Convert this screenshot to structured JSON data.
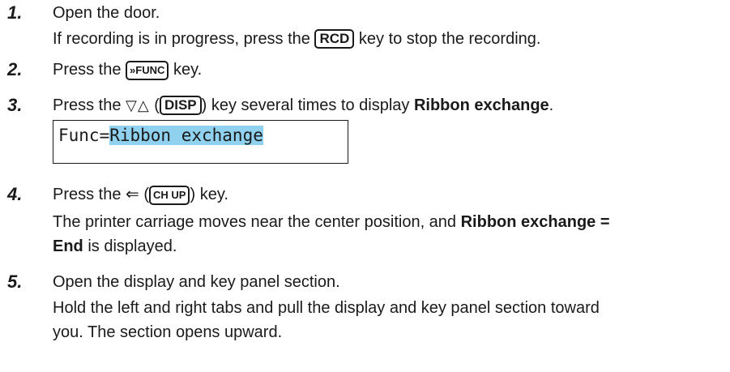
{
  "steps": [
    {
      "num": "1.",
      "text1": "Open the door.",
      "text2a": "If recording is in progress, press the ",
      "key": "RCD",
      "text2b": " key to stop the recording."
    },
    {
      "num": "2.",
      "text_a": "Press the ",
      "key": "»FUNC",
      "text_b": " key."
    },
    {
      "num": "3.",
      "text_a": "Press the ",
      "arrows": "▽△",
      "paren_open": " (",
      "key": "DISP",
      "paren_close": ")",
      "text_b": " key several times to display ",
      "bold": "Ribbon exchange",
      "text_c": "."
    },
    {
      "num": "4.",
      "text_a": "Press the ",
      "enter_symbol": "⇐",
      "paren_open": " (",
      "key": "CH UP",
      "paren_close": ")",
      "text_b": " key.",
      "line2a": "The printer carriage moves near the center position, and ",
      "line2bold": "Ribbon exchange =",
      "line3bold": "End",
      "line3b": " is displayed."
    },
    {
      "num": "5.",
      "text1": "Open the display and key panel section.",
      "text2": "Hold the left and right tabs and pull the display and key panel section toward",
      "text3": "you.  The section opens upward."
    }
  ],
  "lcd": {
    "prefix": "Func=",
    "highlight": "Ribbon exchange"
  },
  "colors": {
    "highlight": "#8fd1ee"
  }
}
